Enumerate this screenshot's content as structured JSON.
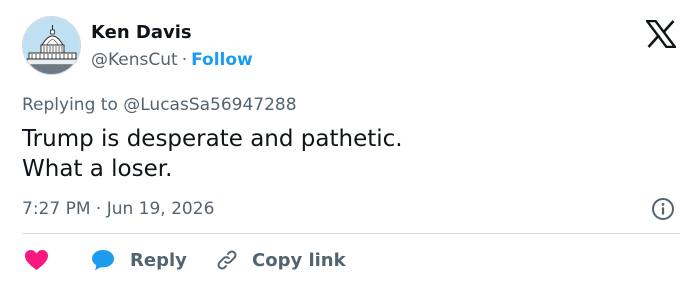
{
  "author": {
    "name": "Ken Davis",
    "handle": "@KensCut",
    "separator": "·",
    "follow_label": "Follow",
    "avatar_icon": "capitol-building-avatar"
  },
  "header": {
    "logo_icon": "x-logo-icon"
  },
  "reply_context": {
    "prefix": "Replying to",
    "mention": "@LucasSa56947288"
  },
  "tweet": {
    "lines": [
      "Trump is desperate and pathetic.",
      "What a loser."
    ],
    "timestamp": "7:27 PM · Jun 19, 2026",
    "info_icon": "info-icon"
  },
  "actions": {
    "like_icon": "heart-icon",
    "reply_icon": "speech-bubble-icon",
    "reply_label": "Reply",
    "copy_icon": "link-icon",
    "copy_label": "Copy link"
  },
  "colors": {
    "accent": "#1d9bf0",
    "like": "#f91880",
    "secondary_text": "#536471",
    "primary_text": "#0f1419",
    "divider": "#cfd9de"
  }
}
